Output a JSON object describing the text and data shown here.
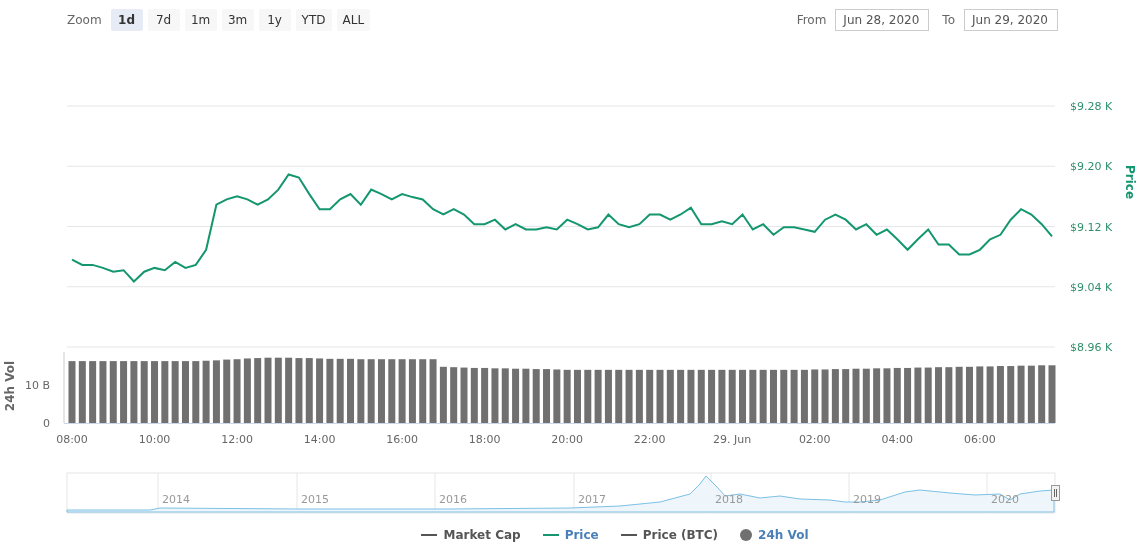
{
  "toolbar": {
    "zoom_label": "Zoom",
    "zoom_buttons": [
      {
        "label": "1d",
        "selected": true
      },
      {
        "label": "7d",
        "selected": false
      },
      {
        "label": "1m",
        "selected": false
      },
      {
        "label": "3m",
        "selected": false
      },
      {
        "label": "1y",
        "selected": false
      },
      {
        "label": "YTD",
        "selected": false
      },
      {
        "label": "ALL",
        "selected": false
      }
    ],
    "from_label": "From",
    "from_value": "Jun 28, 2020",
    "to_label": "To",
    "to_value": "Jun 29, 2020"
  },
  "price_chart": {
    "chart_data": {
      "type": "line",
      "grid": true,
      "ylim": [
        8.96,
        9.28
      ],
      "yticks": [
        {
          "value": 8.96,
          "label": "$8.96 K"
        },
        {
          "value": 9.04,
          "label": "$9.04 K"
        },
        {
          "value": 9.12,
          "label": "$9.12 K"
        },
        {
          "value": 9.2,
          "label": "$9.20 K"
        },
        {
          "value": 9.28,
          "label": "$9.28 K"
        }
      ],
      "series": [
        {
          "name": "Price",
          "color": "#14966f",
          "values": [
            9.076,
            9.069,
            9.069,
            9.065,
            9.06,
            9.062,
            9.047,
            9.06,
            9.065,
            9.062,
            9.073,
            9.065,
            9.069,
            9.089,
            9.149,
            9.156,
            9.16,
            9.156,
            9.149,
            9.156,
            9.169,
            9.189,
            9.185,
            9.163,
            9.143,
            9.143,
            9.156,
            9.163,
            9.149,
            9.169,
            9.163,
            9.156,
            9.163,
            9.159,
            9.156,
            9.143,
            9.136,
            9.143,
            9.136,
            9.123,
            9.123,
            9.129,
            9.116,
            9.123,
            9.116,
            9.116,
            9.119,
            9.116,
            9.129,
            9.123,
            9.116,
            9.119,
            9.136,
            9.123,
            9.119,
            9.123,
            9.136,
            9.136,
            9.129,
            9.136,
            9.145,
            9.123,
            9.123,
            9.127,
            9.123,
            9.136,
            9.116,
            9.123,
            9.109,
            9.119,
            9.119,
            9.116,
            9.113,
            9.129,
            9.136,
            9.129,
            9.116,
            9.123,
            9.109,
            9.116,
            9.103,
            9.089,
            9.103,
            9.116,
            9.096,
            9.096,
            9.083,
            9.083,
            9.089,
            9.103,
            9.109,
            9.129,
            9.143,
            9.136,
            9.123,
            9.107
          ]
        }
      ]
    }
  },
  "volume_chart": {
    "time_labels": [
      "08:00",
      "10:00",
      "12:00",
      "14:00",
      "16:00",
      "18:00",
      "20:00",
      "22:00",
      "29. Jun",
      "02:00",
      "04:00",
      "06:00"
    ],
    "chart_data": {
      "type": "bar",
      "ylim": [
        0,
        18.7
      ],
      "yticks": [
        {
          "value": 0,
          "label": "0"
        },
        {
          "value": 10,
          "label": "10 B"
        }
      ],
      "series": [
        {
          "name": "24h Vol",
          "color": "#707070",
          "values": [
            16.3,
            16.3,
            16.3,
            16.3,
            16.3,
            16.3,
            16.3,
            16.3,
            16.3,
            16.3,
            16.3,
            16.3,
            16.3,
            16.4,
            16.5,
            16.7,
            16.8,
            17.0,
            17.1,
            17.2,
            17.2,
            17.2,
            17.1,
            17.1,
            17.0,
            16.9,
            16.9,
            16.9,
            16.8,
            16.8,
            16.8,
            16.8,
            16.8,
            16.8,
            16.8,
            16.8,
            14.8,
            14.7,
            14.6,
            14.5,
            14.5,
            14.4,
            14.4,
            14.3,
            14.3,
            14.2,
            14.2,
            14.1,
            14.0,
            14.0,
            14.0,
            14.0,
            14.0,
            14.0,
            14.0,
            14.0,
            14.0,
            14.0,
            14.0,
            14.0,
            14.0,
            14.0,
            14.0,
            14.0,
            14.0,
            14.0,
            14.0,
            14.0,
            14.0,
            14.0,
            14.0,
            14.0,
            14.1,
            14.1,
            14.2,
            14.2,
            14.3,
            14.3,
            14.4,
            14.4,
            14.5,
            14.5,
            14.6,
            14.6,
            14.7,
            14.7,
            14.8,
            14.8,
            14.9,
            14.9,
            15.0,
            15.0,
            15.1,
            15.1,
            15.2,
            15.2
          ]
        }
      ]
    }
  },
  "navigator": {
    "years": [
      "2014",
      "2015",
      "2016",
      "2017",
      "2018",
      "2019",
      "2020"
    ]
  },
  "legend": [
    {
      "label": "Market Cap",
      "kind": "line",
      "color": "#555555",
      "active": false
    },
    {
      "label": "Price",
      "kind": "line",
      "color": "#14966f",
      "active": true
    },
    {
      "label": "Price (BTC)",
      "kind": "line",
      "color": "#555555",
      "active": false
    },
    {
      "label": "24h Vol",
      "kind": "dot",
      "color": "#707070",
      "active": true
    }
  ]
}
